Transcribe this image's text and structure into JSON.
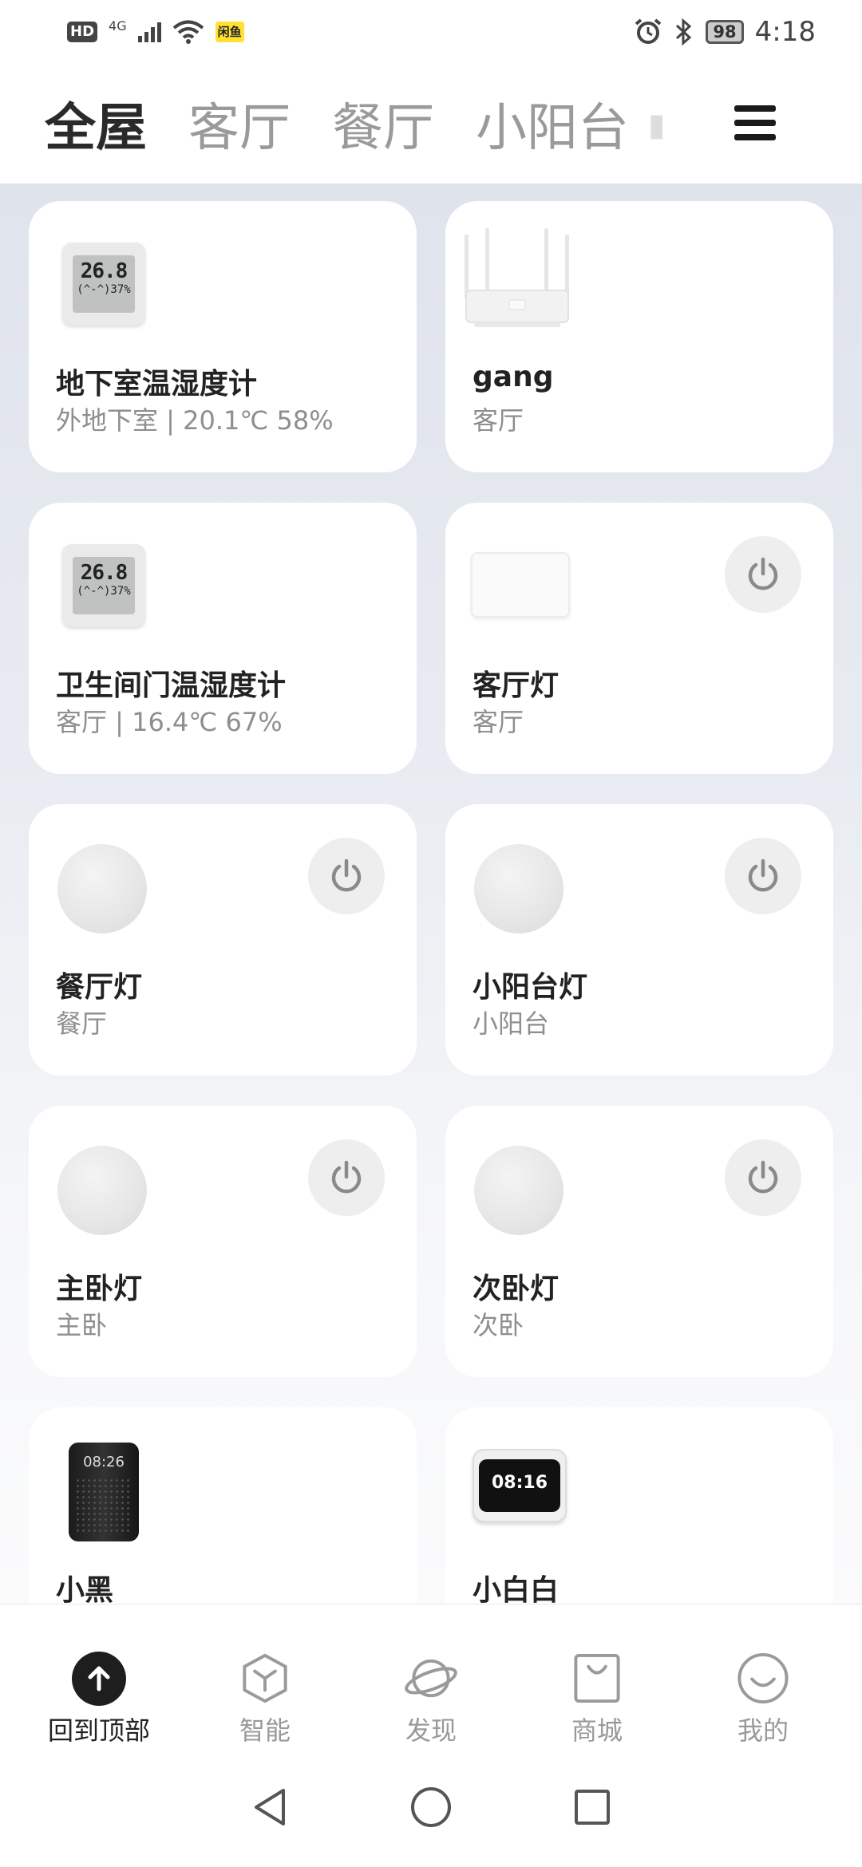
{
  "status_bar": {
    "hd": "HD",
    "network": "4G",
    "app_badge": "闲鱼",
    "battery": "98",
    "time": "4:18"
  },
  "tabs": [
    {
      "label": "全屋",
      "active": true
    },
    {
      "label": "客厅",
      "active": false
    },
    {
      "label": "餐厅",
      "active": false
    },
    {
      "label": "小阳台",
      "active": false
    }
  ],
  "devices": [
    {
      "name": "地下室温湿度计",
      "sub": "外地下室 | 20.1℃ 58%",
      "image": "thermometer",
      "screen_main": "26.8",
      "screen_sub": "(^-^)37%"
    },
    {
      "name": "gang",
      "sub": "客厅",
      "image": "router"
    },
    {
      "name": "卫生间门温湿度计",
      "sub": "客厅 | 16.4℃ 67%",
      "image": "thermometer",
      "screen_main": "26.8",
      "screen_sub": "(^-^)37%"
    },
    {
      "name": "客厅灯",
      "sub": "客厅",
      "image": "panel-light"
    },
    {
      "name": "餐厅灯",
      "sub": "餐厅",
      "image": "ceiling-light"
    },
    {
      "name": "小阳台灯",
      "sub": "小阳台",
      "image": "ceiling-light"
    },
    {
      "name": "主卧灯",
      "sub": "主卧",
      "image": "ceiling-light"
    },
    {
      "name": "次卧灯",
      "sub": "次卧",
      "image": "ceiling-light"
    },
    {
      "name": "小黑",
      "image": "speaker",
      "screen_text": "08:26"
    },
    {
      "name": "小白白",
      "image": "clock-display",
      "screen_text": "08:16"
    }
  ],
  "bottom_nav": [
    {
      "label": "回到顶部",
      "icon": "arrow-up-icon",
      "active": true
    },
    {
      "label": "智能",
      "icon": "cube-icon",
      "active": false
    },
    {
      "label": "发现",
      "icon": "planet-icon",
      "active": false
    },
    {
      "label": "商城",
      "icon": "shopping-bag-icon",
      "active": false
    },
    {
      "label": "我的",
      "icon": "smile-icon",
      "active": false
    }
  ],
  "colors": {
    "accent_dark": "#1e1e1e",
    "inactive": "#999999",
    "card_bg": "#ffffff"
  }
}
